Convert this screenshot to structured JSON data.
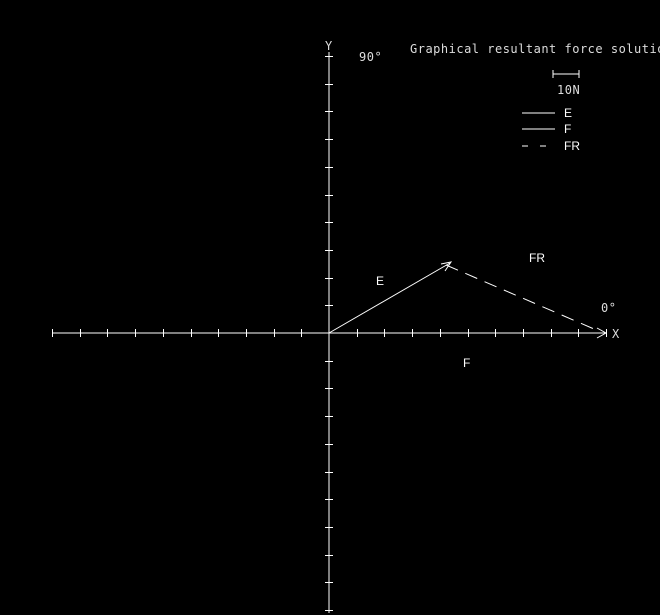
{
  "title": "Graphical resultant force solution",
  "axes": {
    "x_label": "X",
    "y_label": "Y",
    "angle_0_label": "0°",
    "angle_90_label": "90°"
  },
  "scale_bar": {
    "label": "10N"
  },
  "legend": [
    {
      "name": "E",
      "style": "solid"
    },
    {
      "name": "F",
      "style": "solid"
    },
    {
      "name": "FR",
      "style": "dashed"
    }
  ],
  "vectors": {
    "E": {
      "label": "E"
    },
    "F": {
      "label": "F"
    },
    "FR": {
      "label": "FR"
    }
  },
  "colors": {
    "background": "#000000",
    "lines": "#ffffff",
    "text": "#dddddd"
  }
}
